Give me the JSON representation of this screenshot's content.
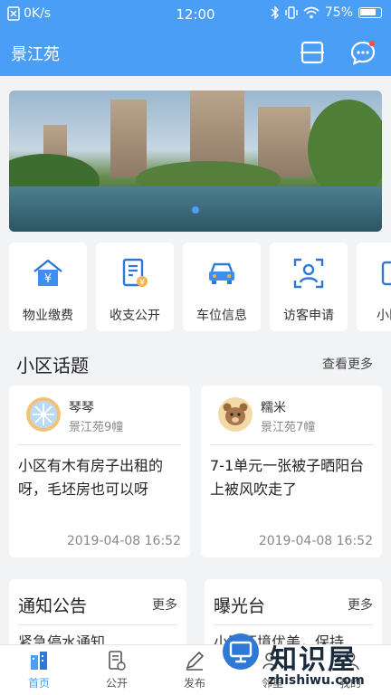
{
  "status_bar": {
    "net_speed": "0K/s",
    "time": "12:00",
    "battery": "75%"
  },
  "header": {
    "title": "景江苑",
    "scan_icon": "scan-icon",
    "message_icon": "message-icon"
  },
  "banner": {
    "slide_index": 1,
    "slide_count": 1
  },
  "quick_actions": [
    {
      "label": "物业缴费",
      "icon": "house-yen-icon"
    },
    {
      "label": "收支公开",
      "icon": "ledger-icon"
    },
    {
      "label": "车位信息",
      "icon": "car-icon"
    },
    {
      "label": "访客申请",
      "icon": "visitor-icon"
    },
    {
      "label": "小区",
      "icon": "more-service-icon"
    }
  ],
  "topics_section": {
    "title": "小区话题",
    "more": "查看更多"
  },
  "topics": [
    {
      "user": "琴琴",
      "location": "景江苑9幢",
      "text": "小区有木有房子出租的呀，毛坯房也可以呀",
      "date": "2019-04-08 16:52"
    },
    {
      "user": "糯米",
      "location": "景江苑7幢",
      "text": "7-1单元一张被子晒阳台上被风吹走了",
      "date": "2019-04-08 16:52"
    }
  ],
  "notice_card": {
    "title": "通知公告",
    "more": "更多",
    "peek": "紧急停水通知"
  },
  "exposure_card": {
    "title": "曝光台",
    "more": "更多",
    "peek": "小区环境优美，保持"
  },
  "tabs": [
    {
      "label": "首页",
      "icon": "home-icon",
      "active": true
    },
    {
      "label": "公开",
      "icon": "ledger-icon",
      "active": false
    },
    {
      "label": "发布",
      "icon": "pen-icon",
      "active": false
    },
    {
      "label": "邻里",
      "icon": "neighbor-icon",
      "active": false
    },
    {
      "label": "我的",
      "icon": "user-icon",
      "active": false
    }
  ],
  "watermark": {
    "title": "知识屋",
    "url": "zhishiwu.com"
  },
  "colors": {
    "primary": "#4a9ef5",
    "background": "#f2f3f5"
  }
}
